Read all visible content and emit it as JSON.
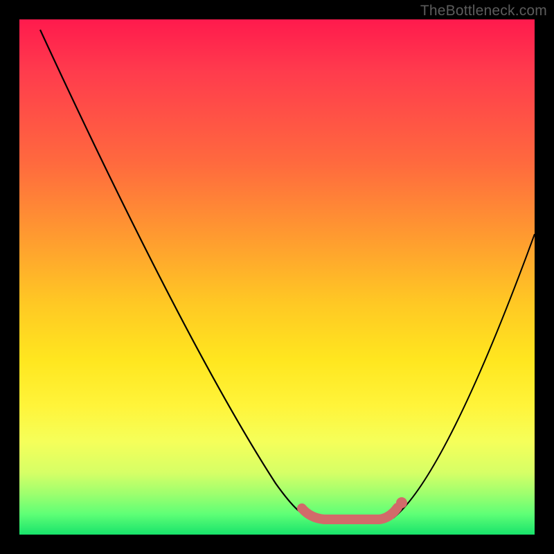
{
  "watermark": "TheBottleneck.com",
  "chart_data": {
    "type": "line",
    "title": "",
    "xlabel": "",
    "ylabel": "",
    "xlim": [
      0,
      100
    ],
    "ylim": [
      0,
      100
    ],
    "series": [
      {
        "name": "left-curve",
        "x": [
          4,
          10,
          16,
          22,
          28,
          34,
          40,
          46,
          52,
          55,
          58
        ],
        "values": [
          98,
          87,
          76,
          65,
          54,
          43,
          32,
          21,
          10,
          5,
          3
        ]
      },
      {
        "name": "right-curve",
        "x": [
          72,
          76,
          80,
          84,
          88,
          92,
          96,
          100
        ],
        "values": [
          3,
          7,
          14,
          22,
          31,
          40,
          49,
          58
        ]
      },
      {
        "name": "flat-bottom-highlight",
        "x": [
          55,
          58,
          61,
          64,
          67,
          70,
          72,
          73
        ],
        "values": [
          4,
          3,
          3,
          3,
          3,
          3,
          3,
          4
        ]
      }
    ],
    "colors": {
      "curve": "#000000",
      "highlight": "#d86a6a"
    }
  }
}
